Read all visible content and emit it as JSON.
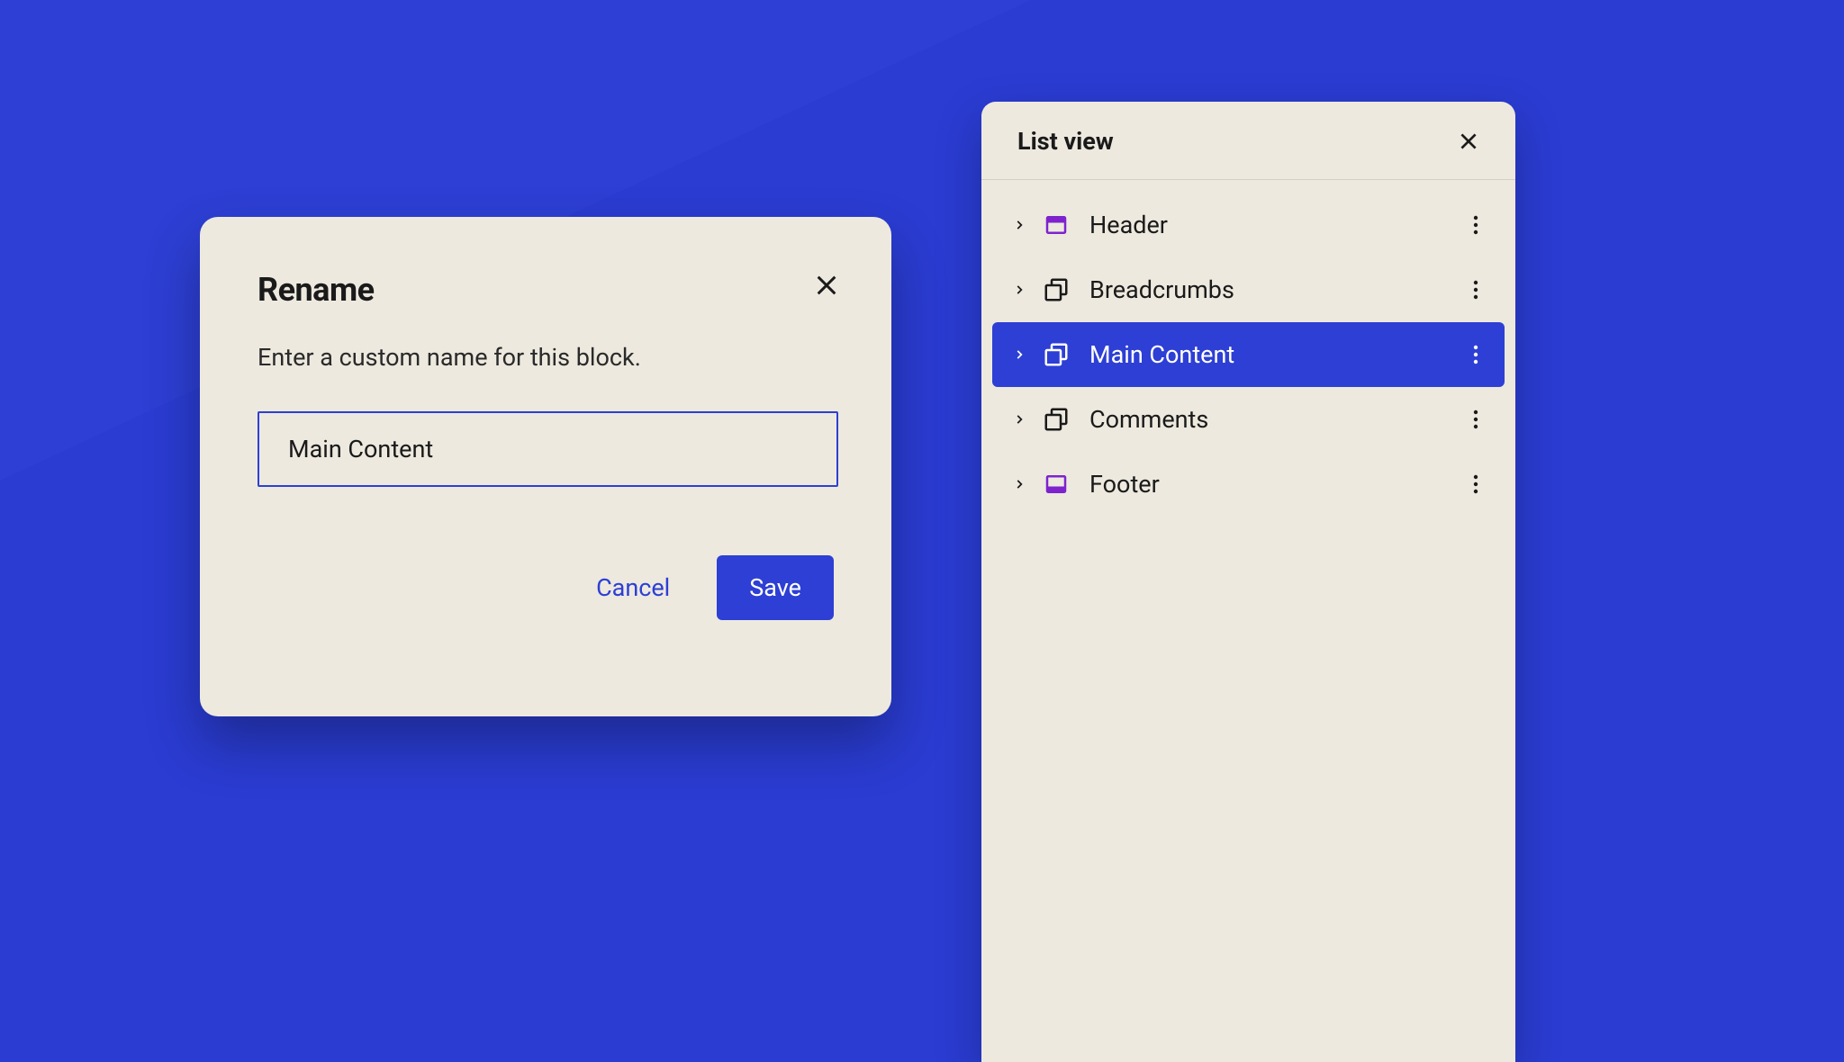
{
  "rename_dialog": {
    "title": "Rename",
    "description": "Enter a custom name for this block.",
    "input_value": "Main Content",
    "cancel_label": "Cancel",
    "save_label": "Save"
  },
  "list_view": {
    "title": "List view",
    "items": [
      {
        "label": "Header",
        "icon": "header-block-icon",
        "selected": false
      },
      {
        "label": "Breadcrumbs",
        "icon": "group-block-icon",
        "selected": false
      },
      {
        "label": "Main Content",
        "icon": "group-block-icon",
        "selected": true
      },
      {
        "label": "Comments",
        "icon": "group-block-icon",
        "selected": false
      },
      {
        "label": "Footer",
        "icon": "footer-block-icon",
        "selected": false
      }
    ]
  },
  "colors": {
    "accent": "#2d3fd4",
    "panel_bg": "#ede9df",
    "purple": "#7e22ce"
  }
}
